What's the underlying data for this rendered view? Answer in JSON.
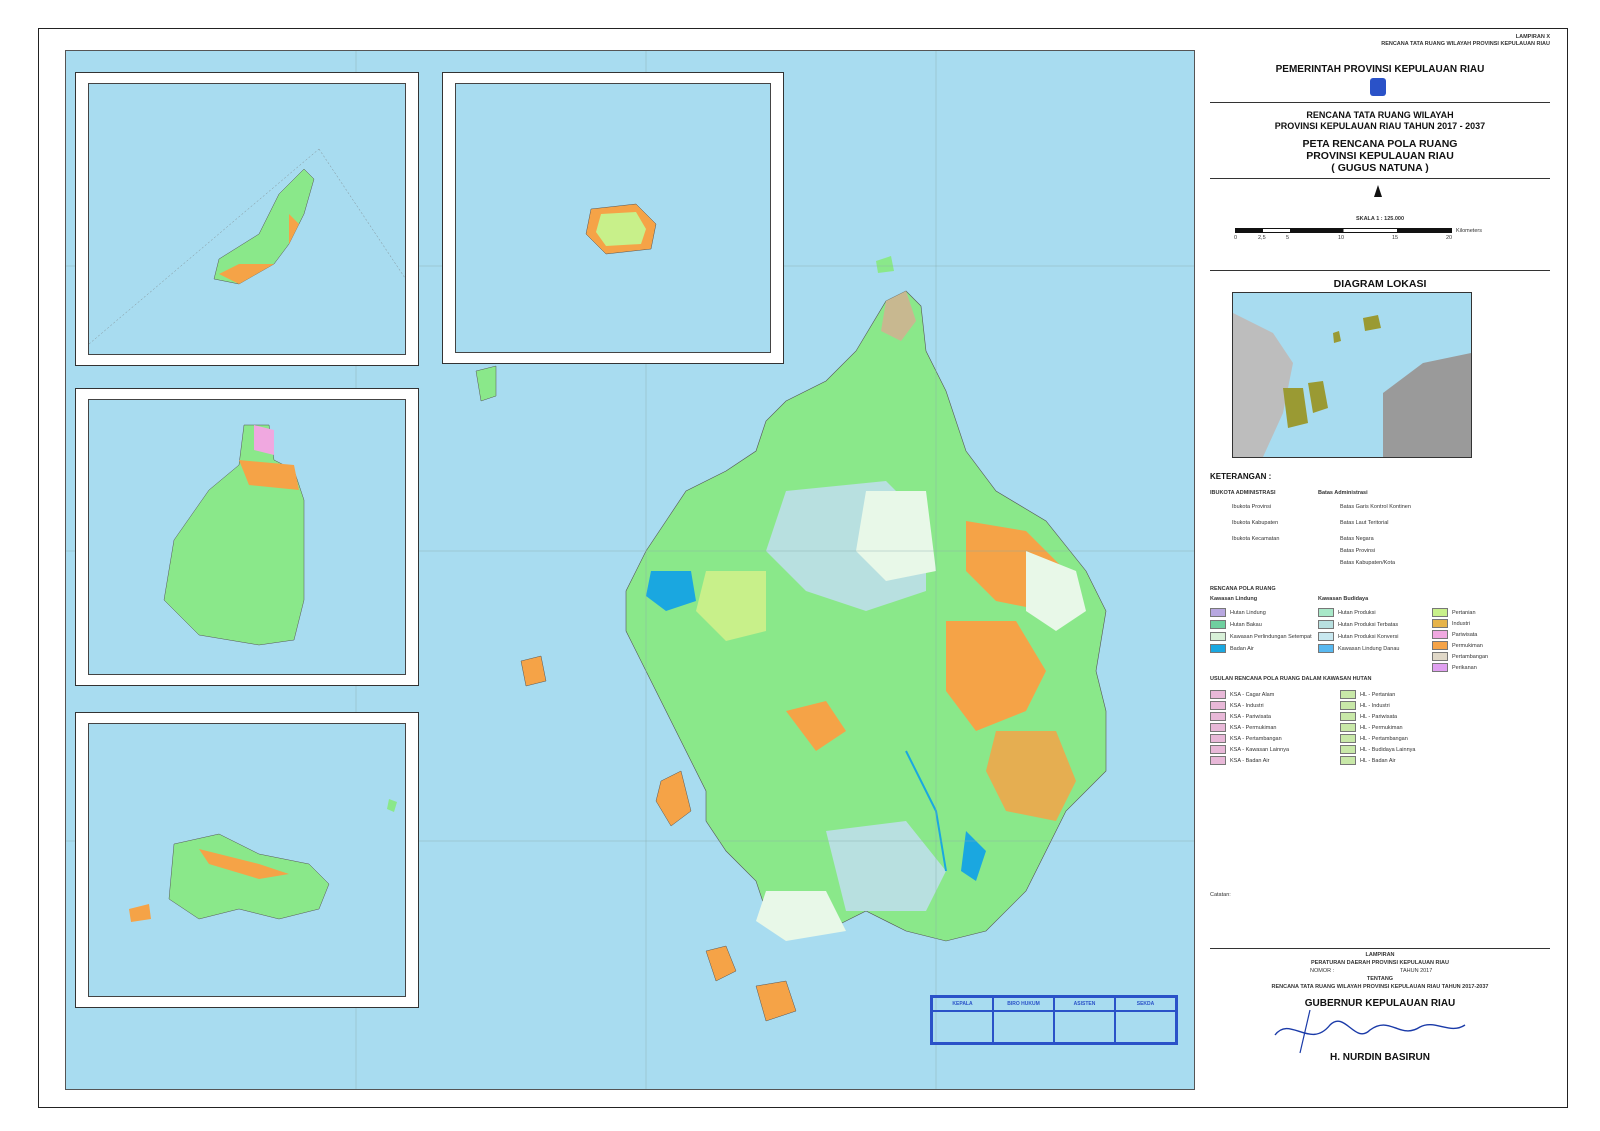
{
  "header": {
    "lampiran": "LAMPIRAN X",
    "subtitle_top": "RENCANA TATA RUANG WILAYAH PROVINSI KEPULAUAN RIAU"
  },
  "legend": {
    "government": "PEMERINTAH PROVINSI KEPULAUAN RIAU",
    "plan_title_1": "RENCANA TATA RUANG WILAYAH",
    "plan_title_2": "PROVINSI KEPULAUAN RIAU TAHUN 2017 - 2037",
    "map_title_1": "PETA RENCANA POLA RUANG",
    "map_title_2": "PROVINSI KEPULAUAN RIAU",
    "map_title_3": "( GUGUS NATUNA )",
    "scale": "SKALA 1 : 125.000",
    "scale_ticks": [
      "0",
      "2,5",
      "5",
      "10",
      "15",
      "20"
    ],
    "scale_unit": "Kilometers",
    "diagram_title": "DIAGRAM LOKASI",
    "keterangan": "KETERANGAN :",
    "admin_title": "IBUKOTA ADMINISTRASI",
    "boundary_title": "Batas Administrasi",
    "admin_items": [
      "Ibukota Provinsi",
      "Ibukota Kabupaten",
      "Ibukota Kecamatan"
    ],
    "boundary_items": [
      "Batas Garis Kontrol Kontinen",
      "Batas Laut Teritorial",
      "Batas Negara",
      "Batas Provinsi",
      "Batas Kabupaten/Kota"
    ],
    "pola_title": "RENCANA POLA RUANG",
    "lindung_title": "Kawasan Lindung",
    "budidaya_title": "Kawasan Budidaya",
    "lindung_items": [
      {
        "label": "Hutan Lindung",
        "color": "#b8a8e0"
      },
      {
        "label": "Hutan Bakau",
        "color": "#6fcf9f"
      },
      {
        "label": "Kawasan Perlindungan Setempat",
        "color": "#d8f0d8"
      },
      {
        "label": "Badan Air",
        "color": "#1aa7e0"
      }
    ],
    "budidaya_items": [
      {
        "label": "Hutan Produksi",
        "color": "#a8e8c8"
      },
      {
        "label": "Hutan Produksi Terbatas",
        "color": "#b8e0e0"
      },
      {
        "label": "Hutan Produksi Konversi",
        "color": "#c8e8f0"
      },
      {
        "label": "Kawasan Lindung Danau",
        "color": "#58b8f0"
      }
    ],
    "budidaya_items_2": [
      {
        "label": "Pertanian",
        "color": "#c8f08a"
      },
      {
        "label": "Industri",
        "color": "#e6b34a"
      },
      {
        "label": "Pariwisata",
        "color": "#f0a8e0"
      },
      {
        "label": "Permukiman",
        "color": "#f5a347"
      },
      {
        "label": "Pertambangan",
        "color": "#e0d8c8"
      },
      {
        "label": "Perikanan",
        "color": "#e0a0f0"
      }
    ],
    "usulan_title": "USULAN RENCANA POLA RUANG DALAM KAWASAN HUTAN",
    "usulan_left": [
      "KSA - Cagar Alam",
      "KSA - Industri",
      "KSA - Pariwisata",
      "KSA - Permukiman",
      "KSA - Pertambangan",
      "KSA - Kawasan Lainnya",
      "KSA - Badan Air"
    ],
    "usulan_right": [
      "HL - Pertanian",
      "HL - Industri",
      "HL - Pariwisata",
      "HL - Permukiman",
      "HL - Pertambangan",
      "HL - Budidaya Lainnya",
      "HL - Badan Air"
    ],
    "catatan": "Catatan:",
    "lampiran_bottom": "LAMPIRAN",
    "perda": "PERATURAN DAERAH PROVINSI KEPULAUAN RIAU",
    "nomor": "NOMOR :",
    "tahun": "TAHUN 2017",
    "tentang": "TENTANG",
    "rtrw_bottom": "RENCANA TATA RUANG WILAYAH PROVINSI KEPULAUAN RIAU TAHUN 2017-2037",
    "gubernur": "GUBERNUR KEPULAUAN RIAU",
    "nama": "H. NURDIN BASIRUN"
  },
  "stamp": {
    "cols": [
      "KEPALA",
      "BIRO HUKUM",
      "ASISTEN",
      "SEKDA"
    ]
  },
  "colors": {
    "sea": "#a8dcf0",
    "forest_green": "#8ae88a",
    "light_green": "#c8f08a",
    "orange": "#f5a347",
    "pale": "#d8f0e8",
    "lake": "#1aa7e0"
  }
}
